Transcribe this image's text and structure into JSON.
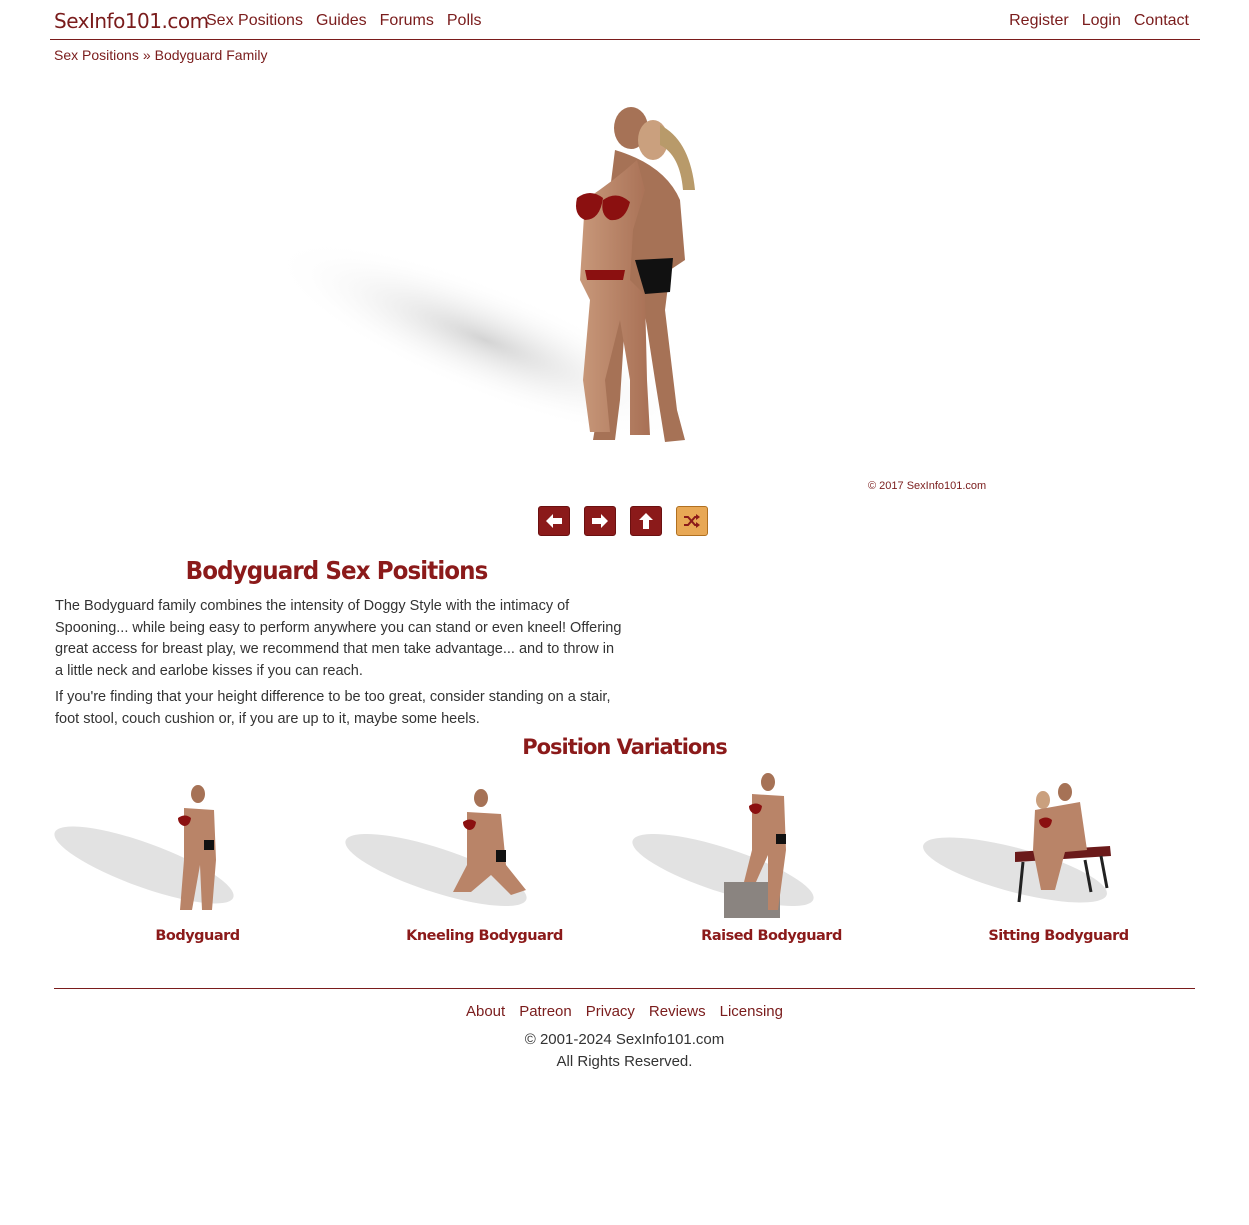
{
  "header": {
    "brand": "SexInfo101.com",
    "nav_left": [
      "Sex Positions",
      "Guides",
      "Forums",
      "Polls"
    ],
    "nav_right": [
      "Register",
      "Login",
      "Contact"
    ]
  },
  "breadcrumb": {
    "parent": "Sex Positions",
    "separator": "»",
    "current": "Bodyguard Family"
  },
  "hero": {
    "copyright": "© 2017 SexInfo101.com",
    "controls": [
      "arrow-left-icon",
      "arrow-right-icon",
      "arrow-up-icon",
      "shuffle-icon"
    ]
  },
  "article": {
    "title": "Bodyguard Sex Positions",
    "paragraphs": [
      "The Bodyguard family combines the intensity of Doggy Style with the intimacy of Spooning... while being easy to perform anywhere you can stand or even kneel! Offering great access for breast play, we recommend that men take advantage... and to throw in a little neck and earlobe kisses if you can reach.",
      "If you're finding that your height difference to be too great, consider standing on a stair, foot stool, couch cushion or, if you are up to it, maybe some heels."
    ]
  },
  "variations": {
    "heading": "Position Variations",
    "items": [
      {
        "label": "Bodyguard"
      },
      {
        "label": "Kneeling Bodyguard"
      },
      {
        "label": "Raised Bodyguard"
      },
      {
        "label": "Sitting Bodyguard"
      }
    ]
  },
  "footer": {
    "links": [
      "About",
      "Patreon",
      "Privacy",
      "Reviews",
      "Licensing"
    ],
    "copyright": "© 2001-2024 SexInfo101.com",
    "rights": "All Rights Reserved."
  },
  "colors": {
    "accent": "#8b1a1a",
    "link": "#7a1c1c",
    "random_button": "#e8a855"
  }
}
